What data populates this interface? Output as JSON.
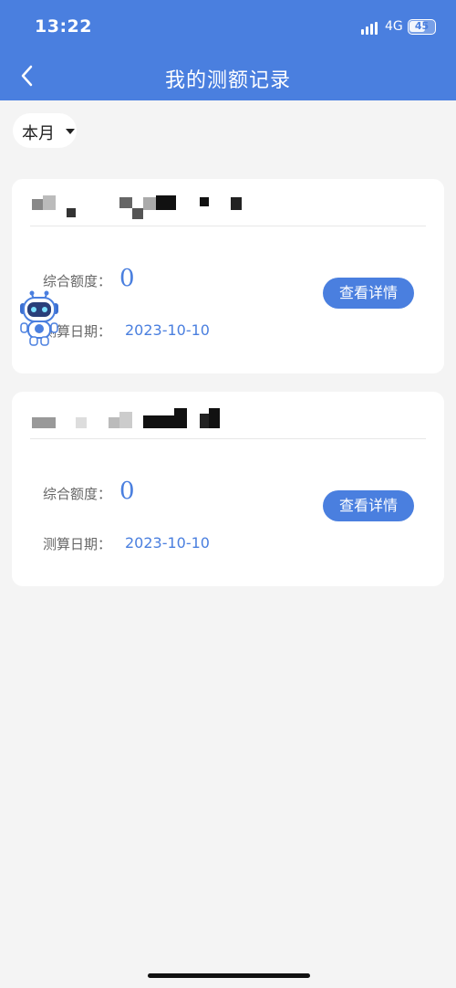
{
  "status_bar": {
    "time": "13:22",
    "network": "4G",
    "battery": "45",
    "icons": [
      "signal-icon",
      "battery-icon"
    ]
  },
  "header": {
    "title": "我的测额记录",
    "back_icon": "chevron-left-icon",
    "background_color": "#4a7fdf"
  },
  "filter": {
    "label": "本月",
    "icon": "caret-down-icon"
  },
  "records": [
    {
      "total_label": "综合额度：",
      "total_value": "0",
      "date_label": "测算日期：",
      "date_value": "2023-10-10",
      "detail_button": "查看详情"
    },
    {
      "total_label": "综合额度：",
      "total_value": "0",
      "date_label": "测算日期：",
      "date_value": "2023-10-10",
      "detail_button": "查看详情"
    }
  ],
  "floating": {
    "icon": "robot-assistant-icon"
  },
  "colors": {
    "accent": "#4a7fdf",
    "page_background": "#f4f4f4",
    "card_background": "#ffffff"
  }
}
